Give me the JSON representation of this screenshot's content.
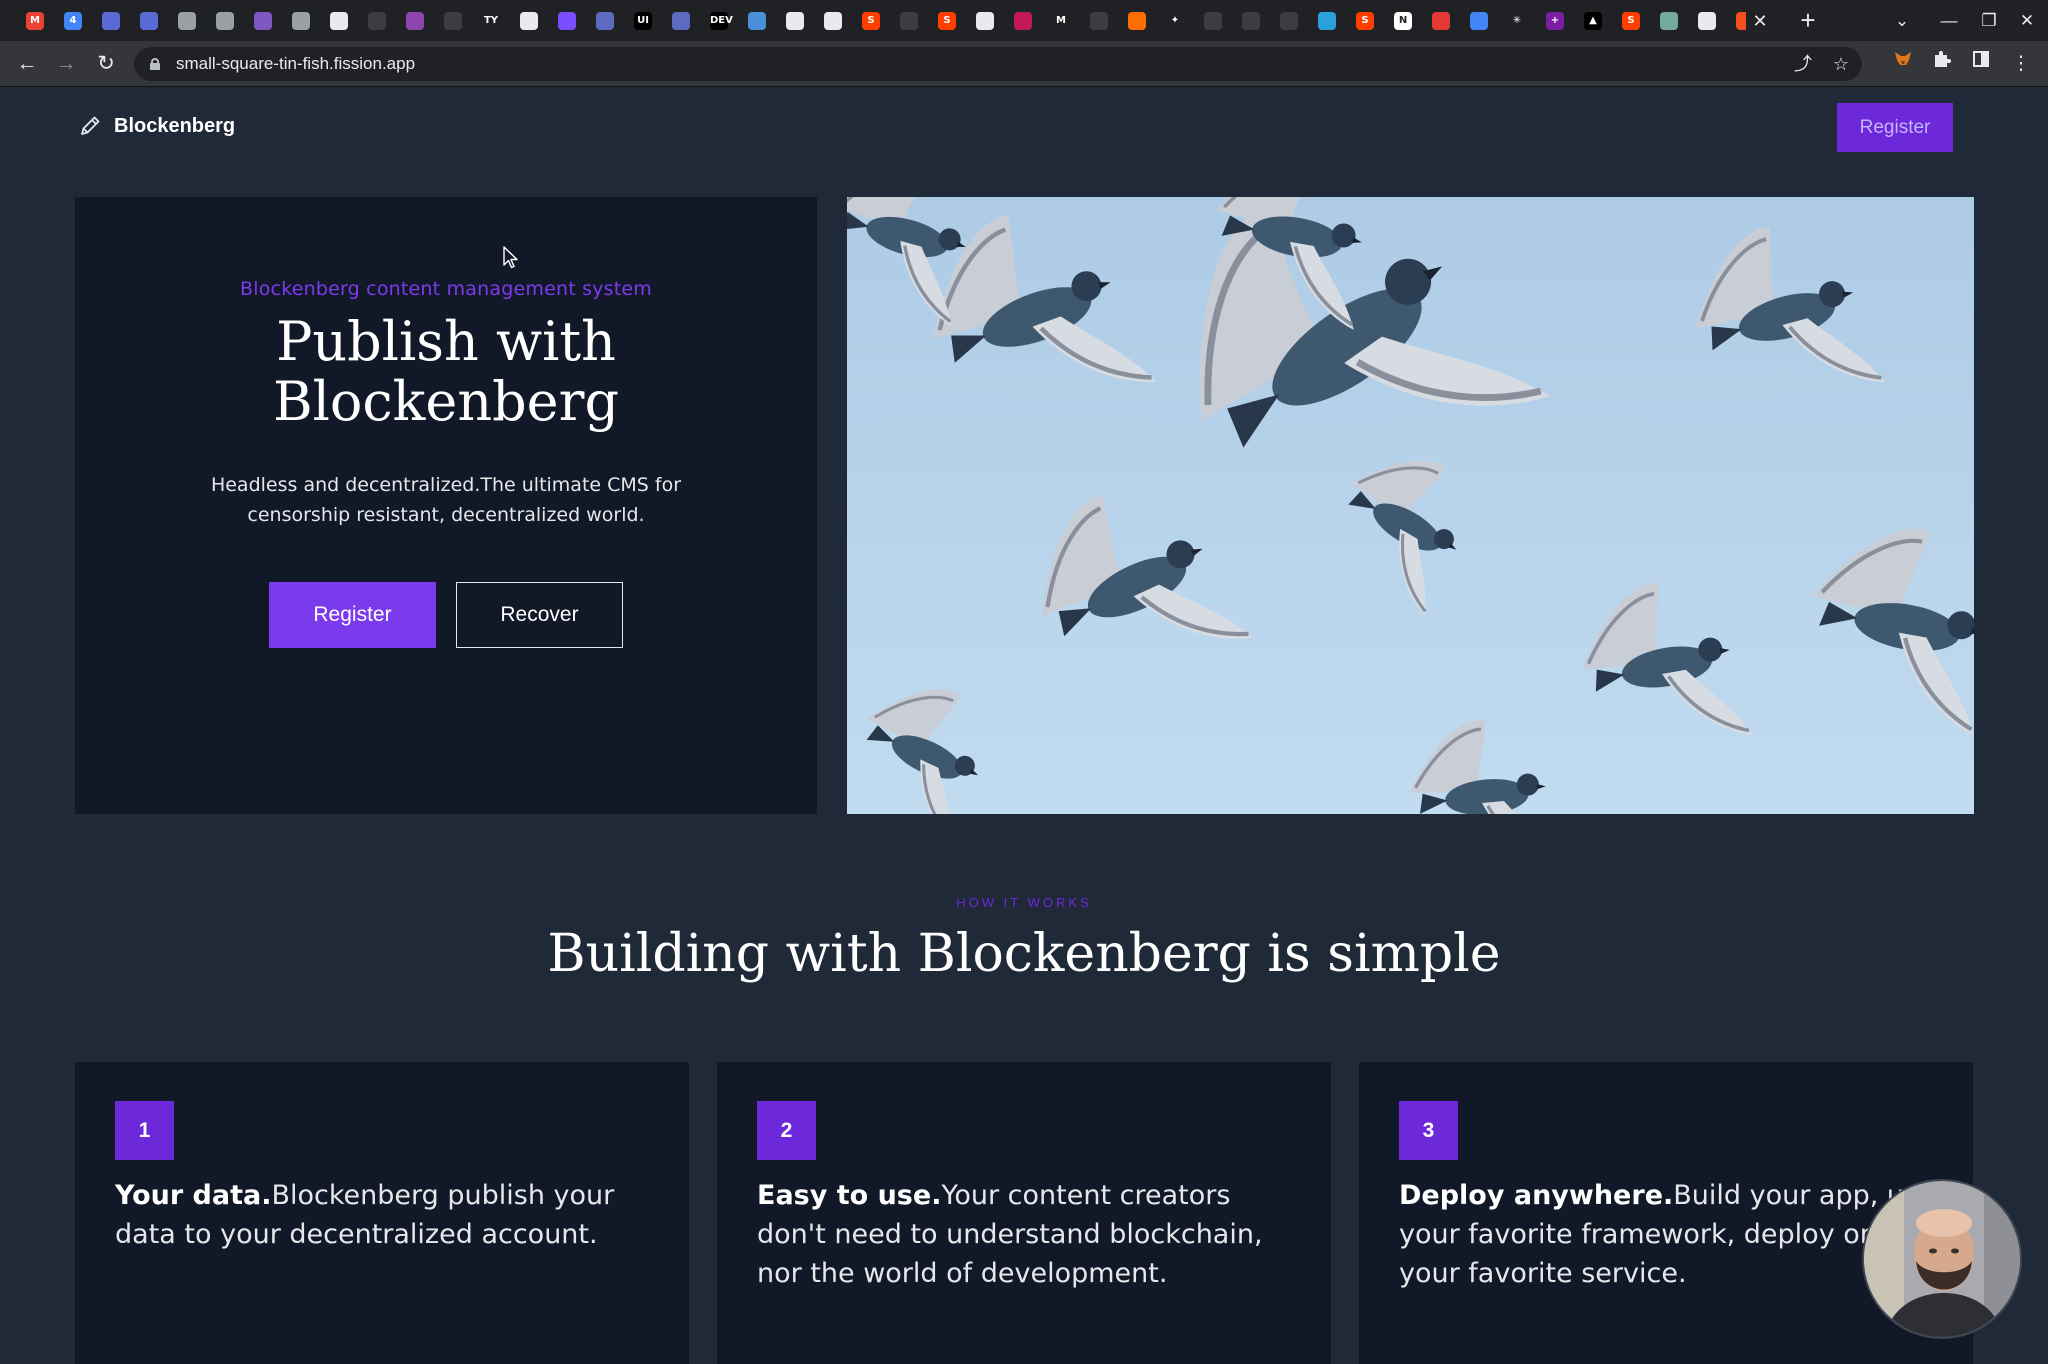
{
  "browser": {
    "tab_icons": [
      {
        "name": "gmail-icon",
        "glyph": "M",
        "color": "#ea4335"
      },
      {
        "name": "calendar-icon",
        "glyph": "4",
        "color": "#4285f4"
      },
      {
        "name": "app-tab-icon",
        "glyph": "",
        "color": "#5b6bd6"
      },
      {
        "name": "app-tab-icon",
        "glyph": "",
        "color": "#5b6bd6"
      },
      {
        "name": "app-tab-icon",
        "glyph": "",
        "color": "#9aa0a6"
      },
      {
        "name": "app-tab-icon",
        "glyph": "",
        "color": "#9aa0a6"
      },
      {
        "name": "app-tab-icon",
        "glyph": "",
        "color": "#7e57c2"
      },
      {
        "name": "app-tab-icon",
        "glyph": "",
        "color": "#9aa0a6"
      },
      {
        "name": "app-tab-icon",
        "glyph": "",
        "color": "#e8eaed"
      },
      {
        "name": "github-dim-icon",
        "glyph": "",
        "color": "#3c3d41"
      },
      {
        "name": "app-tab-icon",
        "glyph": "",
        "color": "#8e44ad"
      },
      {
        "name": "github-dim-icon",
        "glyph": "",
        "color": "#3c3d41"
      },
      {
        "name": "app-tab-icon",
        "glyph": "TY",
        "color": "#202124"
      },
      {
        "name": "github-icon",
        "glyph": "",
        "color": "#e8eaed"
      },
      {
        "name": "app-tab-icon",
        "glyph": "",
        "color": "#7c4dff"
      },
      {
        "name": "app-tab-icon",
        "glyph": "",
        "color": "#5c6bc0"
      },
      {
        "name": "app-tab-icon",
        "glyph": "UI",
        "color": "#000000"
      },
      {
        "name": "shield-icon",
        "glyph": "",
        "color": "#5c6bc0"
      },
      {
        "name": "dev-icon",
        "glyph": "DEV",
        "color": "#000000"
      },
      {
        "name": "app-tab-icon",
        "glyph": "",
        "color": "#4a90d9"
      },
      {
        "name": "globe-icon",
        "glyph": "",
        "color": "#e8eaed"
      },
      {
        "name": "globe-icon",
        "glyph": "",
        "color": "#e8eaed"
      },
      {
        "name": "svelte-icon",
        "glyph": "S",
        "color": "#ff3e00"
      },
      {
        "name": "github-dim-icon",
        "glyph": "",
        "color": "#3c3d41"
      },
      {
        "name": "svelte-icon",
        "glyph": "S",
        "color": "#ff3e00"
      },
      {
        "name": "github-icon",
        "glyph": "",
        "color": "#e8eaed"
      },
      {
        "name": "app-tab-icon",
        "glyph": "",
        "color": "#c2185b"
      },
      {
        "name": "app-tab-icon",
        "glyph": "M",
        "color": "#202124"
      },
      {
        "name": "github-dim-icon",
        "glyph": "",
        "color": "#3c3d41"
      },
      {
        "name": "bookmark-icon",
        "glyph": "",
        "color": "#ff6d00"
      },
      {
        "name": "sparkle-icon",
        "glyph": "✦",
        "color": "#202124"
      },
      {
        "name": "pen-dim-icon",
        "glyph": "",
        "color": "#3c3d41"
      },
      {
        "name": "pen-dim-icon",
        "glyph": "",
        "color": "#3c3d41"
      },
      {
        "name": "pen-dim-icon",
        "glyph": "",
        "color": "#3c3d41"
      },
      {
        "name": "telegram-icon",
        "glyph": "",
        "color": "#2aa1da"
      },
      {
        "name": "svelte-icon",
        "glyph": "S",
        "color": "#ff3e00"
      },
      {
        "name": "notion-icon",
        "glyph": "N",
        "color": "#ffffff"
      },
      {
        "name": "app-tab-icon",
        "glyph": "",
        "color": "#e53935"
      },
      {
        "name": "docs-icon",
        "glyph": "",
        "color": "#4285f4"
      },
      {
        "name": "asterisk-icon",
        "glyph": "✳",
        "color": "#202124"
      },
      {
        "name": "app-tab-icon",
        "glyph": "+",
        "color": "#7b1fa2"
      },
      {
        "name": "vercel-icon",
        "glyph": "▲",
        "color": "#000000"
      },
      {
        "name": "svelte-icon",
        "glyph": "S",
        "color": "#ff3e00"
      },
      {
        "name": "chatgpt-icon",
        "glyph": "",
        "color": "#74aa9c"
      },
      {
        "name": "github-icon",
        "glyph": "",
        "color": "#e8eaed"
      },
      {
        "name": "figma-icon",
        "glyph": "",
        "color": "#f24e1e"
      }
    ],
    "url": "small-square-tin-fish.fission.app"
  },
  "header": {
    "brand": "Blockenberg",
    "register_label": "Register"
  },
  "hero": {
    "eyebrow": "Blockenberg content management system",
    "title_line1": "Publish with",
    "title_line2": "Blockenberg",
    "desc_line1": "Headless and decentralized.The ultimate CMS for",
    "desc_line2": "censorship resistant, decentralized world.",
    "register_label": "Register",
    "recover_label": "Recover"
  },
  "how": {
    "eyebrow": "HOW IT WORKS",
    "title": "Building with Blockenberg is simple",
    "cards": [
      {
        "number": "1",
        "bold": "Your data.",
        "text": "Blockenberg publish your data to your decentralized account."
      },
      {
        "number": "2",
        "bold": "Easy to use.",
        "text": "Your content creators don't need to understand blockchain, nor the world of development."
      },
      {
        "number": "3",
        "bold": "Deploy anywhere.",
        "text": "Build your app, use your favorite framework, deploy on your favorite service."
      }
    ]
  },
  "colors": {
    "page_bg": "#1f2937",
    "panel_bg": "#111827",
    "accent": "#7c3aed",
    "accent_dark": "#6d28d9"
  }
}
